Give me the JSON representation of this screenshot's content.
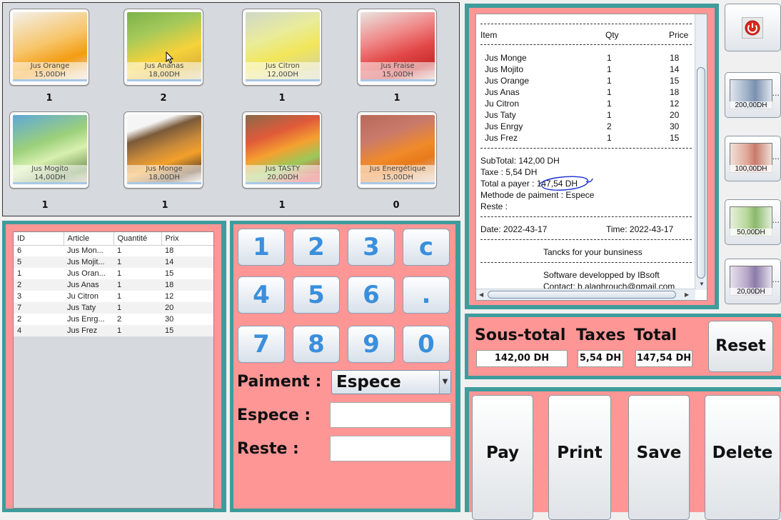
{
  "products": [
    {
      "name": "Jus Orange",
      "price": "15,00DH",
      "qty": "1"
    },
    {
      "name": "Jus Ananas",
      "price": "18,00DH",
      "qty": "2"
    },
    {
      "name": "Jus Citron",
      "price": "12,00DH",
      "qty": "1"
    },
    {
      "name": "Jus Fraise",
      "price": "15,00DH",
      "qty": "1"
    },
    {
      "name": "Jus Mogito",
      "price": "14,00DH",
      "qty": "1"
    },
    {
      "name": "Jus Monge",
      "price": "18,00DH",
      "qty": "1"
    },
    {
      "name": "Jus TASTY",
      "price": "20,00DH",
      "qty": "1"
    },
    {
      "name": "Jus Energétique",
      "price": "15,00DH",
      "qty": "0"
    }
  ],
  "order_table": {
    "headers": [
      "ID",
      "Article",
      "Quantité",
      "Prix"
    ],
    "rows": [
      [
        "6",
        "Jus Mon...",
        "1",
        "18"
      ],
      [
        "5",
        "Jus Mojit...",
        "1",
        "14"
      ],
      [
        "1",
        "Jus Oran...",
        "1",
        "15"
      ],
      [
        "2",
        "Jus Anas",
        "1",
        "18"
      ],
      [
        "3",
        "Ju Citron",
        "1",
        "12"
      ],
      [
        "7",
        "Jus Taty",
        "1",
        "20"
      ],
      [
        "2",
        "Jus Enrg...",
        "2",
        "30"
      ],
      [
        "4",
        "Jus Frez",
        "1",
        "15"
      ]
    ]
  },
  "keypad": {
    "keys": [
      "1",
      "2",
      "3",
      "c",
      "4",
      "5",
      "6",
      ".",
      "7",
      "8",
      "9",
      "0"
    ],
    "paiment_label": "Paiment :",
    "paiment_value": "Espece",
    "espece_label": "Espece :",
    "espece_value": "",
    "reste_label": "Reste :",
    "reste_value": ""
  },
  "receipt": {
    "col_item": "Item",
    "col_qty": "Qty",
    "col_price": "Price",
    "items": [
      [
        "Jus Monge",
        "1",
        "18"
      ],
      [
        "Jus Mojito",
        "1",
        "14"
      ],
      [
        "Jus Orange",
        "1",
        "15"
      ],
      [
        "Jus Anas",
        "1",
        "18"
      ],
      [
        "Ju Citron",
        "1",
        "12"
      ],
      [
        "Jus Taty",
        "1",
        "20"
      ],
      [
        "Jus Enrgy",
        "2",
        "30"
      ],
      [
        "Jus Frez",
        "1",
        "15"
      ]
    ],
    "subtotal": "SubTotal: 142,00 DH",
    "taxe": "Taxe  : 5,54 DH",
    "total": "Total a payer  : 147,54 DH",
    "methode": "Methode de paiment  : Espece",
    "reste": "Reste  :",
    "date": "Date: 2022-43-17",
    "time": "Time: 2022-43-17",
    "thanks": "Tancks for your bunsiness",
    "software": "Software developped by IBsoft",
    "contact": "Contact: b.alaghrouch@gmail.com"
  },
  "totals": {
    "sous_total_label": "Sous-total",
    "taxes_label": "Taxes",
    "total_label": "Total",
    "sous_total_value": "142,00 DH",
    "taxes_value": "5,54 DH",
    "total_value": "147,54 DH",
    "reset_label": "Reset"
  },
  "actions": {
    "pay": "Pay",
    "print": "Print",
    "save": "Save",
    "delete": "Delete"
  },
  "money": [
    {
      "label": "200,00DH",
      "dots": "..."
    },
    {
      "label": "100,00DH",
      "dots": "..."
    },
    {
      "label": "50,00DH",
      "dots": "..."
    },
    {
      "label": "20,00DH",
      "dots": "..."
    }
  ],
  "power_icon": "power-icon",
  "colors": {
    "panel_bg": "#ff9696",
    "panel_border": "#3f9c9c",
    "key_digit": "#3a8fdc",
    "annotation": "#1a2fd6"
  }
}
